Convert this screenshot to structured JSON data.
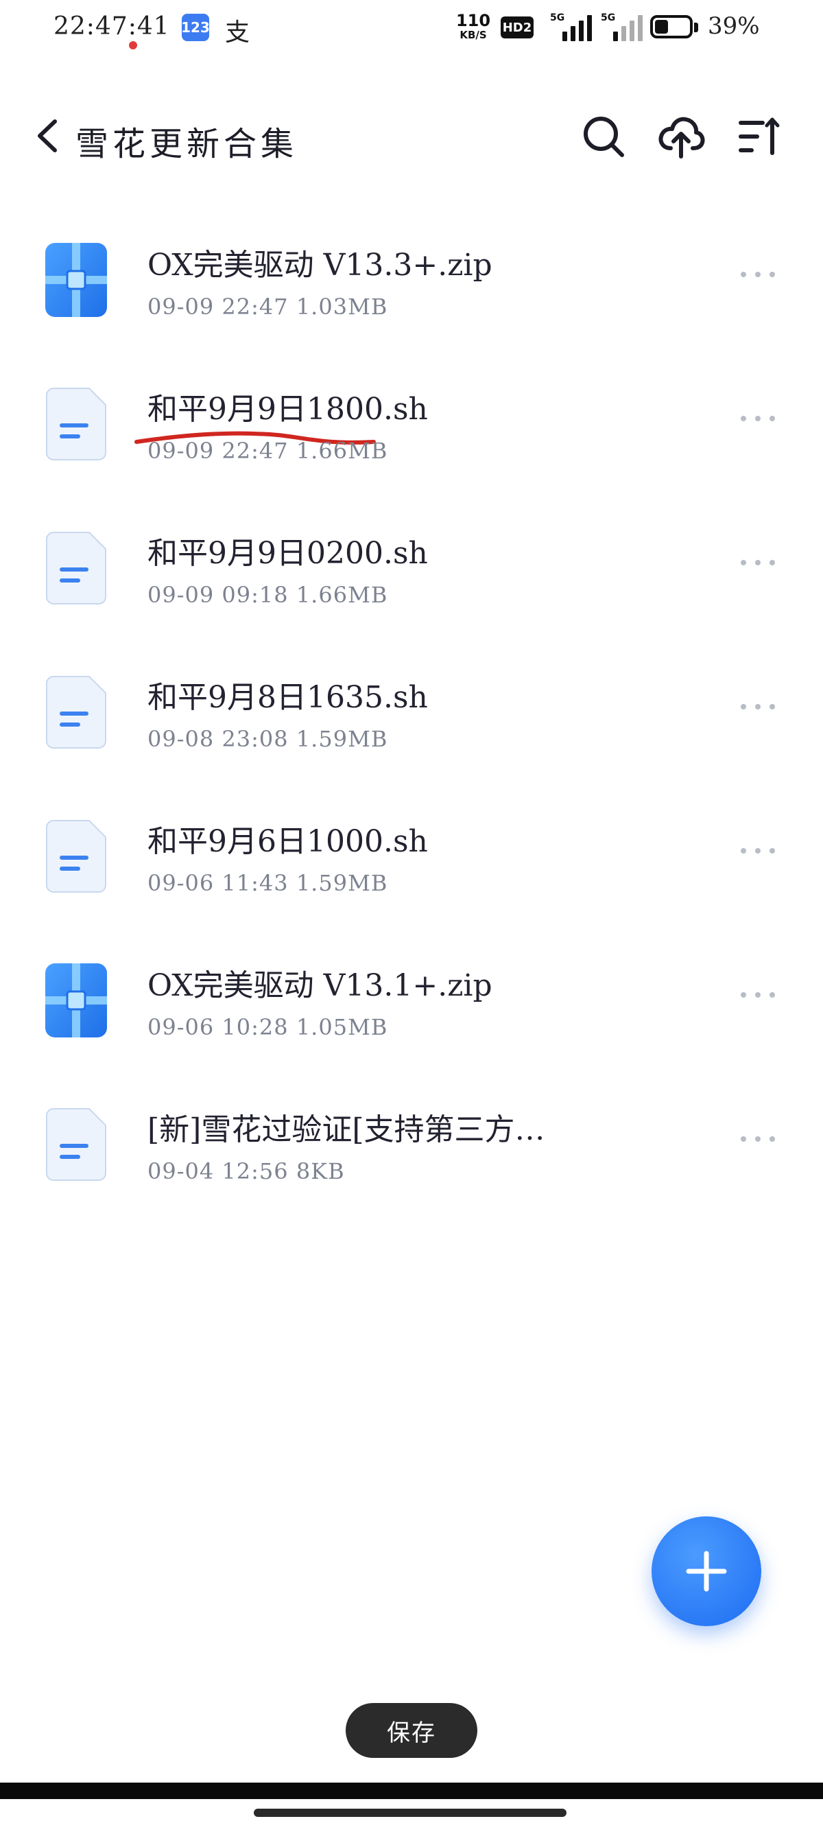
{
  "status_bar": {
    "time": "22:47:41",
    "app_badge": "123",
    "alipay_glyph": "支",
    "net_speed_value": "110",
    "net_speed_unit": "KB/S",
    "hd_label": "HD2",
    "signal_1_label": "5G",
    "signal_2_label": "5G",
    "battery_percent": "39%",
    "battery_level": 0.39
  },
  "header": {
    "back_icon": "chevron-left-icon",
    "title": "雪花更新合集",
    "search_icon": "search-icon",
    "upload_icon": "cloud-upload-icon",
    "sort_icon": "sort-icon"
  },
  "files": [
    {
      "name": "OX完美驱动 V13.3+.zip",
      "meta": "09-09 22:47  1.03MB",
      "icon": "zip-file-icon"
    },
    {
      "name": "和平9月9日1800.sh",
      "meta": "09-09 22:47  1.66MB",
      "icon": "text-file-icon"
    },
    {
      "name": "和平9月9日0200.sh",
      "meta": "09-09 09:18  1.66MB",
      "icon": "text-file-icon"
    },
    {
      "name": "和平9月8日1635.sh",
      "meta": "09-08 23:08  1.59MB",
      "icon": "text-file-icon"
    },
    {
      "name": "和平9月6日1000.sh",
      "meta": "09-06 11:43  1.59MB",
      "icon": "text-file-icon"
    },
    {
      "name": "OX完美驱动 V13.1+.zip",
      "meta": "09-06 10:28  1.05MB",
      "icon": "zip-file-icon"
    },
    {
      "name": "[新]雪花过验证[支持第三方…",
      "meta": "09-04 12:56  8KB",
      "icon": "text-file-icon"
    }
  ],
  "colors": {
    "accent": "#1d6cf2",
    "zip_icon": "#2f86f6",
    "doc_icon_bg": "#edf3fc",
    "doc_icon_line": "#3b82f0",
    "annotation_red": "#d0261f"
  },
  "save_toast": "保存",
  "fab_icon": "plus-icon"
}
